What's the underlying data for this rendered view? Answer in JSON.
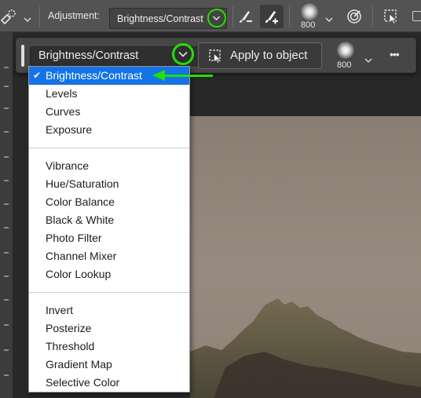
{
  "options_bar": {
    "adjustment_label": "Adjustment:",
    "adjustment_value": "Brightness/Contrast",
    "brush_size": "800"
  },
  "task_bar": {
    "adjustment_value": "Brightness/Contrast",
    "apply_label": "Apply to object",
    "brush_size": "800",
    "more_label": "•••"
  },
  "menu": {
    "group1": [
      "Brightness/Contrast",
      "Levels",
      "Curves",
      "Exposure"
    ],
    "group2": [
      "Vibrance",
      "Hue/Saturation",
      "Color Balance",
      "Black & White",
      "Photo Filter",
      "Channel Mixer",
      "Color Lookup"
    ],
    "group3": [
      "Invert",
      "Posterize",
      "Threshold",
      "Gradient Map",
      "Selective Color"
    ],
    "selected": "Brightness/Contrast",
    "check_mark": "✔"
  },
  "colors": {
    "highlight_green": "#23e000",
    "menu_selection": "#1473e6",
    "toolbar_bg": "#535353",
    "taskbar_bg": "#464646"
  },
  "icons": [
    "object-selection-icon",
    "chevron-down-icon",
    "brush-subtract-icon",
    "brush-add-icon",
    "soft-brush-icon",
    "target-icon",
    "select-subject-icon",
    "checkbox-icon",
    "more-icon"
  ]
}
